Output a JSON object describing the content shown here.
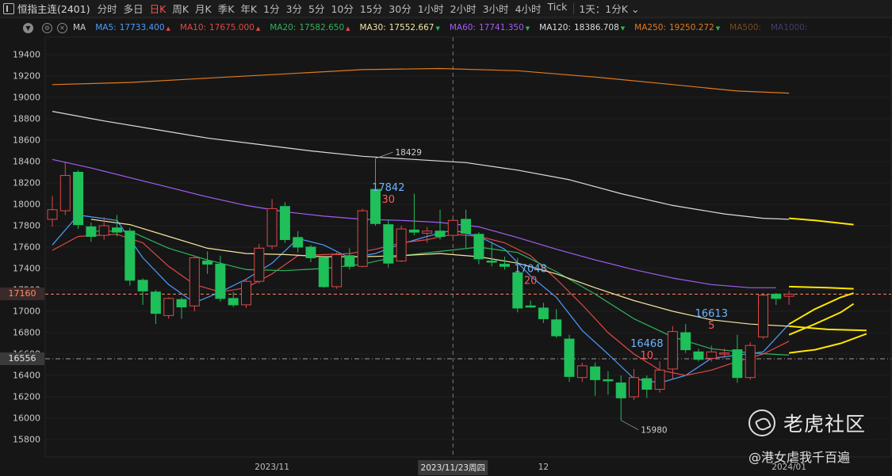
{
  "header": {
    "title": "恒指主连(2401)",
    "periods": [
      {
        "label": "分时",
        "active": false
      },
      {
        "label": "多日",
        "active": false
      },
      {
        "label": "日K",
        "active": true
      },
      {
        "label": "周K",
        "active": false
      },
      {
        "label": "月K",
        "active": false
      },
      {
        "label": "季K",
        "active": false
      },
      {
        "label": "年K",
        "active": false
      },
      {
        "label": "1分",
        "active": false
      },
      {
        "label": "3分",
        "active": false
      },
      {
        "label": "5分",
        "active": false
      },
      {
        "label": "10分",
        "active": false
      },
      {
        "label": "15分",
        "active": false
      },
      {
        "label": "30分",
        "active": false
      },
      {
        "label": "1小时",
        "active": false
      },
      {
        "label": "2小时",
        "active": false
      },
      {
        "label": "3小时",
        "active": false
      },
      {
        "label": "4小时",
        "active": false
      },
      {
        "label": "Tick",
        "active": false
      }
    ],
    "range_dropdown": "1天：1分K",
    "dropdown_icon": "chevron-down-icon"
  },
  "ma_bar": {
    "name": "MA",
    "items": [
      {
        "text": "MA5:",
        "value": "17733.400",
        "color": "#4a9eff",
        "trend": "up"
      },
      {
        "text": "MA10:",
        "value": "17675.000",
        "color": "#e04848",
        "trend": "up"
      },
      {
        "text": "MA20:",
        "value": "17582.650",
        "color": "#2fb35c",
        "trend": "up"
      },
      {
        "text": "MA30:",
        "value": "17552.667",
        "color": "#f5e6a0",
        "trend": "down"
      },
      {
        "text": "MA60:",
        "value": "17741.350",
        "color": "#a35cf5",
        "trend": "down"
      },
      {
        "text": "MA120:",
        "value": "18386.708",
        "color": "#dcdcdc",
        "trend": "down"
      },
      {
        "text": "MA250:",
        "value": "19250.272",
        "color": "#e07a1f",
        "trend": "down"
      },
      {
        "text": "MA500:",
        "value": "",
        "color": "#7a4a1f",
        "trend": ""
      },
      {
        "text": "MA1000:",
        "value": "",
        "color": "#4a3a6a",
        "trend": ""
      }
    ]
  },
  "chart_data": {
    "type": "candlestick",
    "y_ticks": [
      "19400",
      "19200",
      "19000",
      "18800",
      "18600",
      "18400",
      "18200",
      "18000",
      "17800",
      "17600",
      "17400",
      "17200",
      "17000",
      "16800",
      "16600",
      "16400",
      "16200",
      "16000",
      "15800"
    ],
    "ylim": [
      15650,
      19550
    ],
    "price_badges": [
      {
        "label": "17160",
        "value": 17160,
        "color": "#ff8a65"
      },
      {
        "label": "16556",
        "value": 16556,
        "color": "#9a9a9a"
      }
    ],
    "x_labels": [
      {
        "label": "2023/11",
        "index": 17
      },
      {
        "label": "12",
        "index": 38
      },
      {
        "label": "2024/01",
        "index": 57
      }
    ],
    "crosshair": {
      "index": 31,
      "label": "2023/11/23周四"
    },
    "candles": [
      [
        17860,
        17950,
        17790,
        18080
      ],
      [
        17940,
        18270,
        17900,
        18400
      ],
      [
        18300,
        17810,
        17770,
        18320
      ],
      [
        17790,
        17700,
        17650,
        17830
      ],
      [
        17710,
        17800,
        17670,
        17880
      ],
      [
        17780,
        17740,
        17700,
        17900
      ],
      [
        17750,
        17290,
        17240,
        17780
      ],
      [
        17290,
        17190,
        17060,
        17310
      ],
      [
        17180,
        16980,
        16880,
        17200
      ],
      [
        16960,
        17120,
        16930,
        17130
      ],
      [
        17110,
        17040,
        16930,
        17130
      ],
      [
        17050,
        17500,
        17000,
        17520
      ],
      [
        17470,
        17440,
        17350,
        17560
      ],
      [
        17440,
        17120,
        17090,
        17520
      ],
      [
        17120,
        17060,
        17040,
        17180
      ],
      [
        17060,
        17280,
        17030,
        17300
      ],
      [
        17280,
        17590,
        17260,
        17630
      ],
      [
        17610,
        17960,
        17580,
        18050
      ],
      [
        17980,
        17670,
        17640,
        18020
      ],
      [
        17690,
        17600,
        17550,
        17750
      ],
      [
        17600,
        17500,
        17460,
        17620
      ],
      [
        17500,
        17230,
        17220,
        17510
      ],
      [
        17230,
        17530,
        17210,
        17550
      ],
      [
        17520,
        17420,
        17390,
        17590
      ],
      [
        17420,
        17940,
        17410,
        17960
      ],
      [
        18140,
        17820,
        17800,
        18429
      ],
      [
        17810,
        17450,
        17410,
        17860
      ],
      [
        17470,
        17770,
        17460,
        17800
      ],
      [
        17760,
        17740,
        17710,
        18100
      ],
      [
        17730,
        17750,
        17640,
        17790
      ],
      [
        17750,
        17700,
        17670,
        17950
      ],
      [
        17710,
        17850,
        17690,
        17870
      ],
      [
        17860,
        17730,
        17590,
        17950
      ],
      [
        17720,
        17490,
        17440,
        17740
      ],
      [
        17470,
        17460,
        17420,
        17650
      ],
      [
        17440,
        17420,
        17390,
        17510
      ],
      [
        17360,
        17030,
        16990,
        17500
      ],
      [
        17050,
        17048,
        17040,
        17100
      ],
      [
        17030,
        16930,
        16890,
        17080
      ],
      [
        16920,
        16770,
        16750,
        17020
      ],
      [
        16740,
        16390,
        16340,
        16780
      ],
      [
        16380,
        16490,
        16340,
        16520
      ],
      [
        16480,
        16360,
        16210,
        16520
      ],
      [
        16360,
        16350,
        16220,
        16440
      ],
      [
        16330,
        16190,
        15980,
        16400
      ],
      [
        16200,
        16380,
        16170,
        16460
      ],
      [
        16370,
        16270,
        16190,
        16400
      ],
      [
        16270,
        16450,
        16240,
        16530
      ],
      [
        16460,
        16810,
        16370,
        16860
      ],
      [
        16800,
        16640,
        16610,
        16880
      ],
      [
        16620,
        16550,
        16530,
        16650
      ],
      [
        16560,
        16620,
        16530,
        16680
      ],
      [
        16600,
        16610,
        16560,
        16650
      ],
      [
        16640,
        16380,
        16330,
        16780
      ],
      [
        16380,
        16680,
        16360,
        16710
      ],
      [
        16760,
        17150,
        16740,
        17170
      ],
      [
        17160,
        17120,
        17060,
        17170
      ],
      [
        17140,
        17160,
        17060,
        17190
      ]
    ],
    "ma_lines": [
      {
        "name": "MA5",
        "color": "#4a9eff",
        "points": [
          [
            0,
            17620
          ],
          [
            2,
            17900
          ],
          [
            5,
            17850
          ],
          [
            7,
            17500
          ],
          [
            9,
            17250
          ],
          [
            11,
            17080
          ],
          [
            13,
            17180
          ],
          [
            15,
            17300
          ],
          [
            17,
            17450
          ],
          [
            19,
            17680
          ],
          [
            21,
            17620
          ],
          [
            23,
            17500
          ],
          [
            25,
            17540
          ],
          [
            27,
            17630
          ],
          [
            29,
            17700
          ],
          [
            31,
            17760
          ],
          [
            33,
            17700
          ],
          [
            35,
            17580
          ],
          [
            37,
            17330
          ],
          [
            39,
            17130
          ],
          [
            41,
            16820
          ],
          [
            43,
            16600
          ],
          [
            45,
            16370
          ],
          [
            47,
            16330
          ],
          [
            49,
            16400
          ],
          [
            51,
            16560
          ],
          [
            53,
            16590
          ],
          [
            55,
            16620
          ],
          [
            57,
            16880
          ]
        ]
      },
      {
        "name": "MA10",
        "color": "#e04848",
        "points": [
          [
            0,
            17570
          ],
          [
            2,
            17700
          ],
          [
            5,
            17720
          ],
          [
            7,
            17640
          ],
          [
            9,
            17420
          ],
          [
            11,
            17250
          ],
          [
            13,
            17180
          ],
          [
            15,
            17220
          ],
          [
            17,
            17350
          ],
          [
            19,
            17520
          ],
          [
            21,
            17530
          ],
          [
            23,
            17540
          ],
          [
            25,
            17580
          ],
          [
            27,
            17640
          ],
          [
            29,
            17670
          ],
          [
            31,
            17720
          ],
          [
            33,
            17700
          ],
          [
            35,
            17640
          ],
          [
            37,
            17520
          ],
          [
            39,
            17300
          ],
          [
            41,
            17060
          ],
          [
            43,
            16800
          ],
          [
            45,
            16600
          ],
          [
            47,
            16450
          ],
          [
            49,
            16400
          ],
          [
            51,
            16450
          ],
          [
            53,
            16530
          ],
          [
            55,
            16600
          ],
          [
            57,
            16720
          ]
        ]
      },
      {
        "name": "MA20",
        "color": "#2fb35c",
        "points": [
          [
            3,
            17750
          ],
          [
            6,
            17750
          ],
          [
            9,
            17590
          ],
          [
            12,
            17480
          ],
          [
            15,
            17390
          ],
          [
            18,
            17380
          ],
          [
            21,
            17400
          ],
          [
            24,
            17440
          ],
          [
            27,
            17520
          ],
          [
            30,
            17560
          ],
          [
            33,
            17600
          ],
          [
            36,
            17550
          ],
          [
            39,
            17370
          ],
          [
            42,
            17160
          ],
          [
            45,
            16930
          ],
          [
            48,
            16760
          ],
          [
            51,
            16650
          ],
          [
            54,
            16610
          ],
          [
            57,
            16590
          ]
        ]
      },
      {
        "name": "MA30",
        "color": "#f5e6a0",
        "points": [
          [
            3,
            17860
          ],
          [
            6,
            17810
          ],
          [
            9,
            17700
          ],
          [
            12,
            17590
          ],
          [
            15,
            17540
          ],
          [
            18,
            17530
          ],
          [
            21,
            17510
          ],
          [
            24,
            17510
          ],
          [
            27,
            17520
          ],
          [
            30,
            17540
          ],
          [
            33,
            17510
          ],
          [
            36,
            17450
          ],
          [
            39,
            17350
          ],
          [
            42,
            17220
          ],
          [
            45,
            17100
          ],
          [
            48,
            17000
          ],
          [
            51,
            16920
          ],
          [
            54,
            16880
          ],
          [
            57,
            16860
          ]
        ]
      },
      {
        "name": "MA60",
        "color": "#a35cf5",
        "points": [
          [
            0,
            18420
          ],
          [
            3,
            18340
          ],
          [
            6,
            18250
          ],
          [
            9,
            18160
          ],
          [
            12,
            18070
          ],
          [
            15,
            17990
          ],
          [
            18,
            17930
          ],
          [
            21,
            17890
          ],
          [
            24,
            17860
          ],
          [
            27,
            17850
          ],
          [
            30,
            17830
          ],
          [
            33,
            17790
          ],
          [
            36,
            17690
          ],
          [
            39,
            17580
          ],
          [
            42,
            17480
          ],
          [
            45,
            17390
          ],
          [
            48,
            17310
          ],
          [
            51,
            17250
          ],
          [
            54,
            17220
          ],
          [
            56,
            17220
          ]
        ]
      },
      {
        "name": "MA120",
        "color": "#dcdcdc",
        "points": [
          [
            0,
            18870
          ],
          [
            4,
            18780
          ],
          [
            8,
            18700
          ],
          [
            12,
            18620
          ],
          [
            16,
            18560
          ],
          [
            20,
            18500
          ],
          [
            24,
            18450
          ],
          [
            28,
            18420
          ],
          [
            32,
            18390
          ],
          [
            36,
            18320
          ],
          [
            40,
            18230
          ],
          [
            44,
            18100
          ],
          [
            48,
            17990
          ],
          [
            52,
            17910
          ],
          [
            55,
            17870
          ],
          [
            57,
            17860
          ]
        ]
      },
      {
        "name": "MA250",
        "color": "#e07a1f",
        "points": [
          [
            0,
            19120
          ],
          [
            6,
            19140
          ],
          [
            12,
            19180
          ],
          [
            18,
            19220
          ],
          [
            24,
            19260
          ],
          [
            30,
            19270
          ],
          [
            36,
            19250
          ],
          [
            42,
            19190
          ],
          [
            48,
            19120
          ],
          [
            53,
            19060
          ],
          [
            57,
            19040
          ]
        ]
      }
    ],
    "projections": [
      {
        "color": "#ffe600",
        "points": [
          [
            57,
            17870
          ],
          [
            59,
            17850
          ],
          [
            62,
            17810
          ]
        ]
      },
      {
        "color": "#ffe600",
        "points": [
          [
            57,
            17230
          ],
          [
            60,
            17220
          ],
          [
            62,
            17210
          ]
        ]
      },
      {
        "color": "#ffe600",
        "points": [
          [
            57,
            16860
          ],
          [
            60,
            16830
          ],
          [
            63,
            16820
          ]
        ]
      },
      {
        "color": "#ffe600",
        "points": [
          [
            57,
            16880
          ],
          [
            59,
            17020
          ],
          [
            61,
            17130
          ],
          [
            62,
            17170
          ]
        ]
      },
      {
        "color": "#ffe600",
        "points": [
          [
            57,
            16780
          ],
          [
            59,
            16880
          ],
          [
            61,
            16990
          ],
          [
            62,
            17070
          ]
        ]
      },
      {
        "color": "#ffe600",
        "points": [
          [
            57,
            16610
          ],
          [
            59,
            16640
          ],
          [
            61,
            16700
          ],
          [
            63,
            16790
          ]
        ]
      }
    ],
    "annotations": [
      {
        "index": 26,
        "price": "17842",
        "day": "30"
      },
      {
        "index": 37,
        "price": "17048",
        "day": "20"
      },
      {
        "index": 46,
        "price": "16468",
        "day": "10"
      },
      {
        "index": 51,
        "price": "16613",
        "day": "5"
      }
    ],
    "extremes": [
      {
        "index": 25,
        "value": "18429",
        "pos": "high"
      },
      {
        "index": 44,
        "value": "15980",
        "pos": "low"
      }
    ],
    "up_color": "#e04848",
    "down_color": "#1fbf5a"
  },
  "watermark": {
    "brand": "老虎社区",
    "brand_icon": "tiger-logo-icon",
    "author": "@港女虐我千百遍"
  }
}
